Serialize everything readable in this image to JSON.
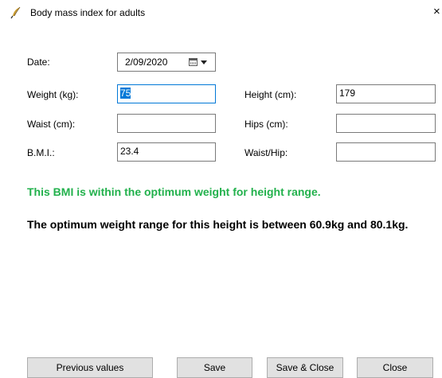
{
  "window": {
    "title": "Body mass index for adults",
    "close_glyph": "×",
    "title_icon": "feather-pen-icon"
  },
  "form": {
    "date_label": "Date:",
    "date_value": "2/09/2020",
    "weight_label": "Weight (kg):",
    "weight_value": "75",
    "height_label": "Height (cm):",
    "height_value": "179",
    "waist_label": "Waist (cm):",
    "waist_value": "",
    "hips_label": "Hips (cm):",
    "hips_value": "",
    "bmi_label": "B.M.I.:",
    "bmi_value": "23.4",
    "waisthip_label": "Waist/Hip:",
    "waisthip_value": ""
  },
  "messages": {
    "status": "This BMI is within the optimum weight for height range.",
    "status_color": "#22b14c",
    "range": "The optimum weight range for this height is between 60.9kg and 80.1kg."
  },
  "buttons": {
    "previous": "Previous values",
    "save": "Save",
    "save_close": "Save & Close",
    "close": "Close"
  }
}
